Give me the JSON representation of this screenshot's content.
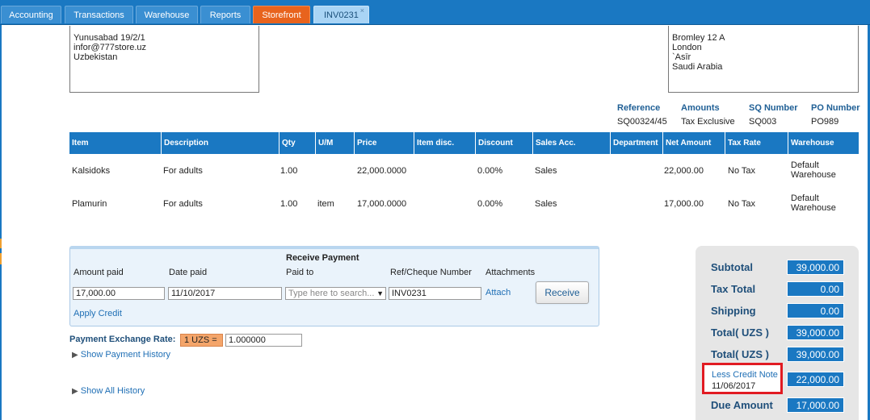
{
  "tabs": [
    {
      "label": "Accounting"
    },
    {
      "label": "Transactions"
    },
    {
      "label": "Warehouse"
    },
    {
      "label": "Reports"
    },
    {
      "label": "Storefront"
    },
    {
      "label": "INV0231",
      "close": "×"
    }
  ],
  "from_address": [
    "Yunusabad 19/2/1",
    "infor@777store.uz",
    "Uzbekistan"
  ],
  "to_address": [
    "Bromley 12 A",
    "London",
    "`Asīr",
    "Saudi Arabia"
  ],
  "meta": {
    "headers": [
      "Reference",
      "Amounts",
      "SQ Number",
      "PO Number"
    ],
    "values": [
      "SQ00324/45",
      "Tax Exclusive",
      "SQ003",
      "PO989"
    ]
  },
  "table": {
    "headers": [
      "Item",
      "Description",
      "Qty",
      "U/M",
      "Price",
      "Item disc.",
      "Discount",
      "Sales Acc.",
      "Department",
      "Net Amount",
      "Tax Rate",
      "Warehouse"
    ],
    "rows": [
      {
        "item": "Kalsidoks",
        "description": "For adults",
        "qty": "1.00",
        "um": "",
        "price": "22,000.0000",
        "item_disc": "",
        "discount": "0.00%",
        "sales_acc": "Sales",
        "department": "",
        "net_amount": "22,000.00",
        "tax_rate": "No Tax",
        "warehouse_1": "Default",
        "warehouse_2": "Warehouse"
      },
      {
        "item": "Plamurin",
        "description": "For adults",
        "qty": "1.00",
        "um": "item",
        "price": "17,000.0000",
        "item_disc": "",
        "discount": "0.00%",
        "sales_acc": "Sales",
        "department": "",
        "net_amount": "17,000.00",
        "tax_rate": "No Tax",
        "warehouse_1": "Default",
        "warehouse_2": "Warehouse"
      }
    ]
  },
  "payment": {
    "title": "Receive Payment",
    "amount_label": "Amount paid",
    "amount_value": "17,000.00",
    "date_label": "Date paid",
    "date_value": "11/10/2017",
    "paid_to_label": "Paid to",
    "paid_to_placeholder": "Type here to search...",
    "ref_label": "Ref/Cheque Number",
    "ref_value": "INV0231",
    "attachments_label": "Attachments",
    "attach_link": "Attach",
    "receive_button": "Receive",
    "apply_credit": "Apply Credit"
  },
  "exchange": {
    "label": "Payment Exchange Rate:",
    "currency": "1 UZS =",
    "rate": "1.000000"
  },
  "history": {
    "payment_history": "Show Payment History",
    "all_history": "Show All History"
  },
  "totals": {
    "subtotal_label": "Subtotal",
    "subtotal": "39,000.00",
    "tax_label": "Tax Total",
    "tax": "0.00",
    "shipping_label": "Shipping",
    "shipping": "0.00",
    "total1_label": "Total( UZS )",
    "total1": "39,000.00",
    "total2_label": "Total( UZS )",
    "total2": "39,000.00",
    "credit_label": "Less Credit Note",
    "credit_date": "11/06/2017",
    "credit": "22,000.00",
    "due_label": "Due Amount",
    "due": "17,000.00"
  },
  "colors": {
    "brand": "#1a78c2",
    "storefront_tab": "#e8631d",
    "highlight": "#e11b22"
  }
}
